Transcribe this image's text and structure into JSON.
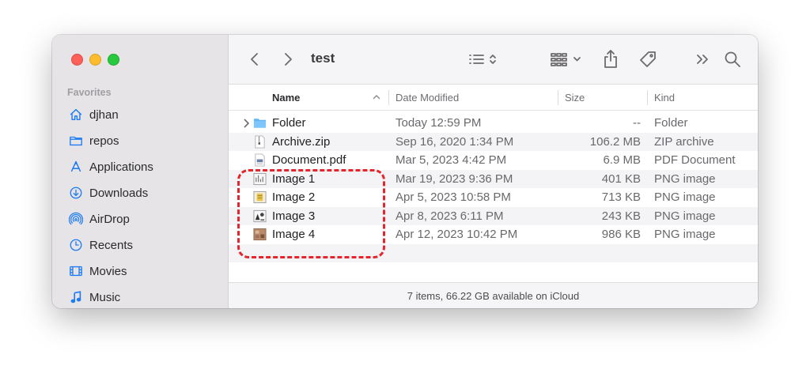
{
  "window": {
    "title": "test"
  },
  "sidebar": {
    "heading": "Favorites",
    "items": [
      {
        "label": "djhan",
        "icon": "home-icon"
      },
      {
        "label": "repos",
        "icon": "folder-icon"
      },
      {
        "label": "Applications",
        "icon": "applications-icon"
      },
      {
        "label": "Downloads",
        "icon": "downloads-icon"
      },
      {
        "label": "AirDrop",
        "icon": "airdrop-icon"
      },
      {
        "label": "Recents",
        "icon": "recents-icon"
      },
      {
        "label": "Movies",
        "icon": "movies-icon"
      },
      {
        "label": "Music",
        "icon": "music-icon"
      }
    ]
  },
  "toolbar": {
    "icons": [
      "back-icon",
      "forward-icon",
      "list-view-icon",
      "group-icon",
      "share-icon",
      "tag-icon",
      "more-icon",
      "search-icon"
    ]
  },
  "columns": {
    "name": "Name",
    "date": "Date Modified",
    "size": "Size",
    "kind": "Kind"
  },
  "files": [
    {
      "name": "Folder",
      "date": "Today 12:59 PM",
      "size": "--",
      "kind": "Folder",
      "icon": "folder-icon"
    },
    {
      "name": "Archive.zip",
      "date": "Sep 16, 2020 1:34 PM",
      "size": "106.2 MB",
      "kind": "ZIP archive",
      "icon": "zip-file-icon"
    },
    {
      "name": "Document.pdf",
      "date": "Mar 5, 2023 4:42 PM",
      "size": "6.9 MB",
      "kind": "PDF Document",
      "icon": "pdf-file-icon"
    },
    {
      "name": "Image 1",
      "date": "Mar 19, 2023 9:36 PM",
      "size": "401 KB",
      "kind": "PNG image",
      "icon": "image-thumbnail-icon"
    },
    {
      "name": "Image 2",
      "date": "Apr 5, 2023 10:58 PM",
      "size": "713 KB",
      "kind": "PNG image",
      "icon": "image-thumbnail-icon"
    },
    {
      "name": "Image 3",
      "date": "Apr 8, 2023 6:11 PM",
      "size": "243 KB",
      "kind": "PNG image",
      "icon": "image-thumbnail-icon"
    },
    {
      "name": "Image 4",
      "date": "Apr 12, 2023 10:42 PM",
      "size": "986 KB",
      "kind": "PNG image",
      "icon": "image-thumbnail-icon"
    }
  ],
  "status": "7 items, 66.22 GB available on iCloud",
  "colors": {
    "accent": "#1f7cf4",
    "highlight": "#e5242b"
  }
}
